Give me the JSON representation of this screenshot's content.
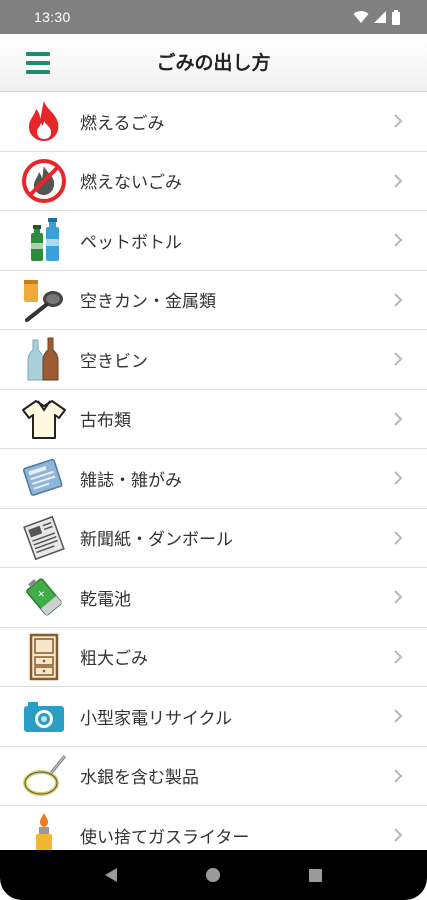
{
  "status_bar": {
    "time": "13:30"
  },
  "app_bar": {
    "title": "ごみの出し方"
  },
  "list": [
    {
      "label": "燃えるごみ",
      "icon": "fire-icon"
    },
    {
      "label": "燃えないごみ",
      "icon": "no-fire-icon"
    },
    {
      "label": "ペットボトル",
      "icon": "pet-bottle-icon"
    },
    {
      "label": "空きカン・金属類",
      "icon": "can-metal-icon"
    },
    {
      "label": "空きビン",
      "icon": "glass-bottle-icon"
    },
    {
      "label": "古布類",
      "icon": "shirt-icon"
    },
    {
      "label": "雑誌・雑がみ",
      "icon": "magazine-icon"
    },
    {
      "label": "新聞紙・ダンボール",
      "icon": "newspaper-icon"
    },
    {
      "label": "乾電池",
      "icon": "battery-icon"
    },
    {
      "label": "粗大ごみ",
      "icon": "furniture-icon"
    },
    {
      "label": "小型家電リサイクル",
      "icon": "camera-icon"
    },
    {
      "label": "水銀を含む製品",
      "icon": "fluorescent-lamp-icon"
    },
    {
      "label": "使い捨てガスライター",
      "icon": "lighter-icon"
    }
  ],
  "colors": {
    "accent": "#1f8a70",
    "status_bar": "#808080",
    "nav_bar": "#000000"
  }
}
